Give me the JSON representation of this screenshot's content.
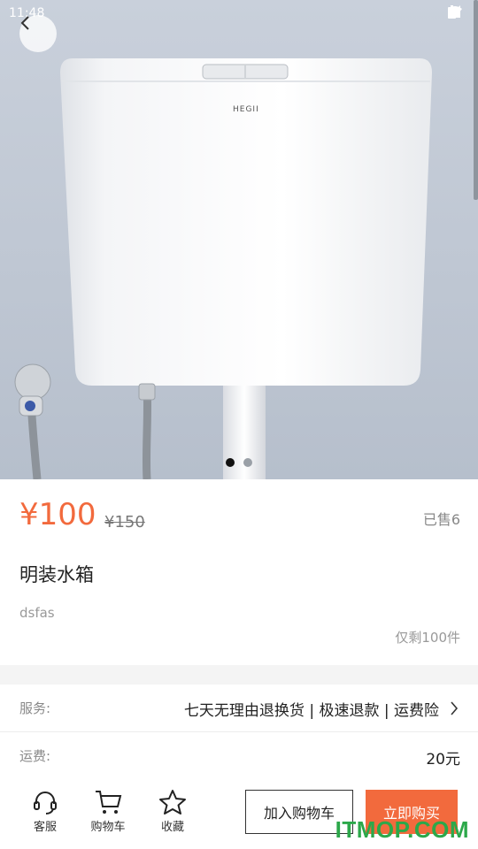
{
  "status_bar": {
    "time": "11:48"
  },
  "hero": {
    "brand_on_tank": "HEGII",
    "carousel_count": 2,
    "carousel_active": 1
  },
  "product": {
    "price": "¥100",
    "original_price": "¥150",
    "sold": "已售6",
    "title": "明装水箱",
    "description": "dsfas",
    "stock": "仅剩100件"
  },
  "service": {
    "label": "服务:",
    "value": "七天无理由退换货 | 极速退款 | 运费险"
  },
  "shipping": {
    "label": "运费:",
    "value": "20元"
  },
  "bottom_bar": {
    "customer_service": "客服",
    "cart": "购物车",
    "favorite": "收藏",
    "add_to_cart": "加入购物车",
    "buy_now": "立即购买"
  },
  "watermark": "ITMOP.COM",
  "colors": {
    "accent": "#f26a3d",
    "watermark": "#2ca84a"
  }
}
